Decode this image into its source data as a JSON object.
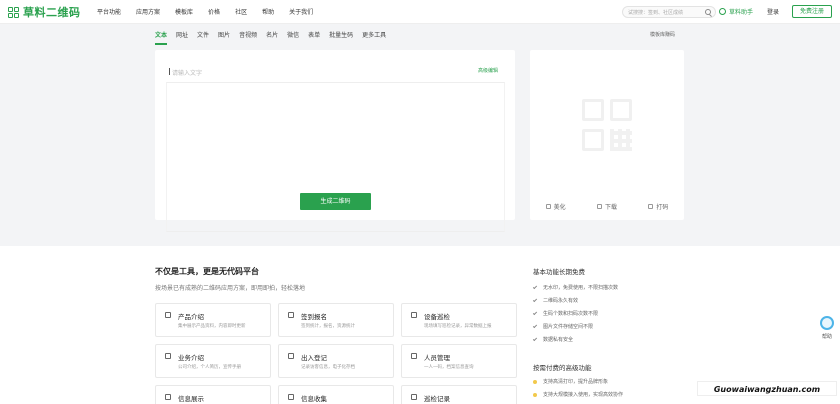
{
  "brand": {
    "name": "草料二维码"
  },
  "nav": [
    "平台功能",
    "应用方案",
    "模板库",
    "价格",
    "社区",
    "帮助",
    "关于我们"
  ],
  "search": {
    "placeholder": "试搜搜：签到、社区成绩"
  },
  "header": {
    "assistant": "草料助手",
    "login": "登录",
    "register": "免费注册"
  },
  "tabs": [
    "文本",
    "网址",
    "文件",
    "图片",
    "音视频",
    "名片",
    "微信",
    "表单",
    "批量生码",
    "更多工具"
  ],
  "template_link": "模板库赚码",
  "editor": {
    "placeholder": "请输入文字",
    "advanced": "高级编辑",
    "generate": "生成二维码"
  },
  "preview_actions": [
    "美化",
    "下载",
    "打码"
  ],
  "lower": {
    "headline": "不仅是工具，更是无代码平台",
    "subline": "按场景已有成熟的二维码应用方案，即用即拍，轻松落地",
    "features": [
      {
        "title": "产品介绍",
        "desc": "集中展示产品资料，内容即时更新"
      },
      {
        "title": "签到报名",
        "desc": "签到统计，报名，资源统计"
      },
      {
        "title": "设备巡检",
        "desc": "现场填写巡检记录，异常数据上报"
      },
      {
        "title": "业务介绍",
        "desc": "公司介绍，个人简历，宣传手册"
      },
      {
        "title": "出入登记",
        "desc": "记录访客信息，电子化存档"
      },
      {
        "title": "人员管理",
        "desc": "一人一码，档案信息查询"
      },
      {
        "title": "信息展示",
        "desc": ""
      },
      {
        "title": "信息收集",
        "desc": ""
      },
      {
        "title": "巡检记录",
        "desc": ""
      }
    ],
    "benefits_title": "基本功能长期免费",
    "benefits": [
      "无水印，免费使用，不限扫描次数",
      "二维码永久有效",
      "生码个数和扫码次数不限",
      "图片文件存储空间不限",
      "数据私有安全"
    ],
    "paid_title": "按需付费的高级功能",
    "paid": [
      "支持高清打印，提升品牌形象",
      "支持大规模接入使用，实现高效协作"
    ]
  },
  "float_help": "帮助",
  "watermark": "Guowaiwangzhuan.com"
}
